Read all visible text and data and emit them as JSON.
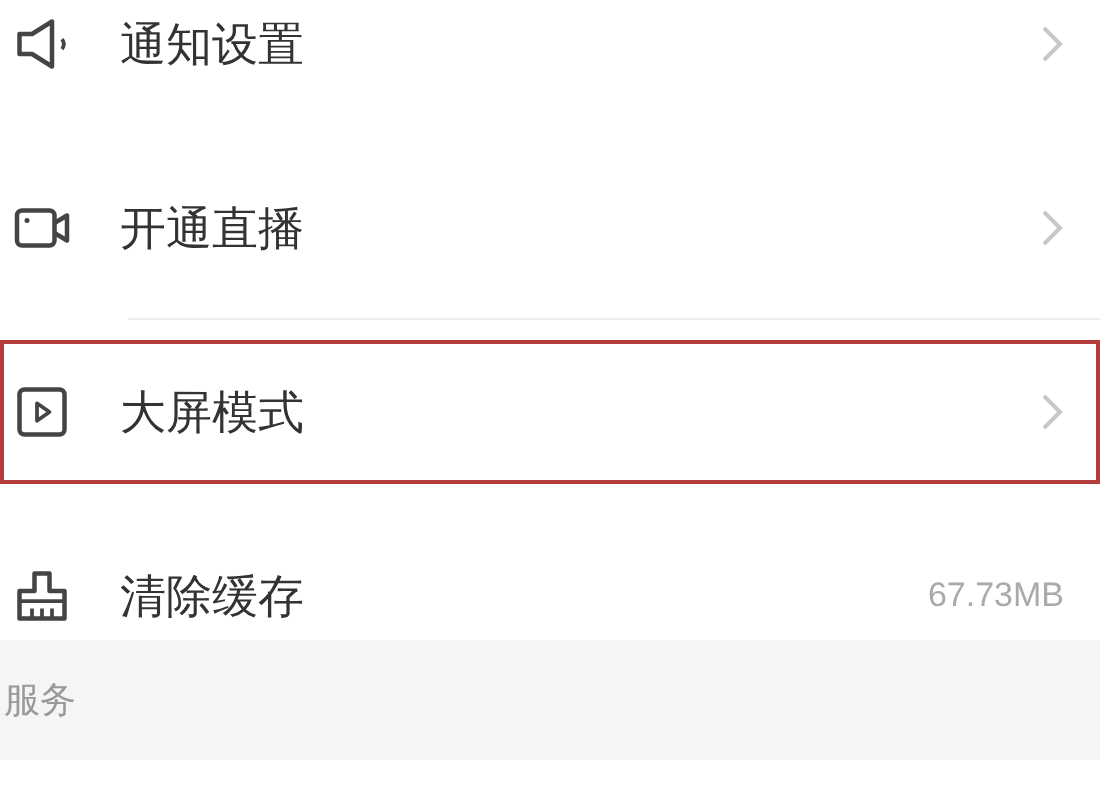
{
  "settings": [
    {
      "kind": "speaker",
      "label": "通知设置",
      "chevron": true,
      "highlighted": false
    },
    {
      "kind": "camera",
      "label": "开通直播",
      "chevron": true,
      "highlighted": false
    },
    {
      "kind": "play",
      "label": "大屏模式",
      "chevron": true,
      "highlighted": true
    },
    {
      "kind": "broom",
      "label": "清除缓存",
      "value": "67.73MB",
      "chevron": false,
      "highlighted": false
    }
  ],
  "section_header": "服务"
}
